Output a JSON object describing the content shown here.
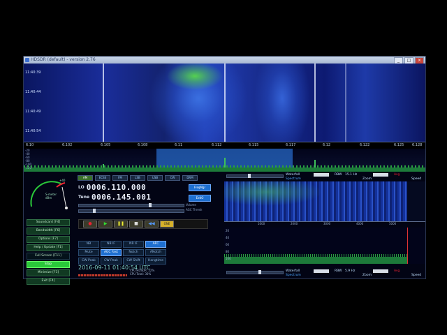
{
  "window": {
    "title": "HDSDR (default) - version 2.76",
    "buttons": [
      "_",
      "□",
      "×"
    ]
  },
  "waterfall": {
    "timestamps": [
      "11:40:39",
      "11:40:44",
      "11:40:49",
      "11:40:54"
    ]
  },
  "freq_ticks": [
    "6.10",
    "6.102",
    "6.105",
    "6.108",
    "6.11",
    "6.112",
    "6.115",
    "6.117",
    "6.12",
    "6.122",
    "6.125",
    "6.128"
  ],
  "spectrum": {
    "db_labels": [
      "-20",
      "-40",
      "-60",
      "-80",
      "-100",
      "-120"
    ]
  },
  "smeter": {
    "top_label": "+40",
    "label": "S-meter",
    "units": "dBm"
  },
  "tabs": [
    "AM",
    "ECSS",
    "FM",
    "LSB",
    "USB",
    "CW",
    "DRM"
  ],
  "lo": {
    "label": "LO",
    "value": "0006.110.000"
  },
  "tune": {
    "label": "Tune",
    "value": "0006.145.001"
  },
  "side_buttons": {
    "freq_mgr": "FreqMgr",
    "extio": "ExtIO"
  },
  "volume_label": "Volume",
  "agc_thresh_label": "AGC Thresh",
  "left_buttons": [
    {
      "label": "Soundcard [F4]",
      "style": "normal"
    },
    {
      "label": "Bandwidth [F6]",
      "style": "normal"
    },
    {
      "label": "Options [F7]",
      "style": "normal"
    },
    {
      "label": "Help / Update [F1]",
      "style": "normal"
    },
    {
      "label": "Full Screen [F11]",
      "style": "plain"
    },
    {
      "label": "Stop",
      "style": "on"
    },
    {
      "label": "Minimize [F3]",
      "style": "normal"
    },
    {
      "label": "Exit [F4]",
      "style": "normal"
    }
  ],
  "transport": {
    "record": "●",
    "play": "▶",
    "pause": "❚❚",
    "stop": "■",
    "rewind": "◀◀",
    "flag": "ONE"
  },
  "mode_buttons": [
    {
      "label": "NB",
      "selected": false
    },
    {
      "label": "NB IF",
      "selected": false
    },
    {
      "label": "NR IF",
      "selected": false
    },
    {
      "label": "AFC",
      "selected": true
    },
    {
      "label": "Mute",
      "selected": false
    },
    {
      "label": "AGC Fast",
      "selected": true
    },
    {
      "label": "Notch",
      "selected": false
    },
    {
      "label": "ANotch",
      "selected": false
    },
    {
      "label": "CW Peak",
      "selected": false
    },
    {
      "label": "CW Peak",
      "selected": false
    },
    {
      "label": "CW Shift",
      "selected": false
    },
    {
      "label": "Hangtime",
      "selected": false
    }
  ],
  "clock": "2016-09-11  01:40:54 UTC",
  "cpu": {
    "line1": "CPU HDSDR: 22%",
    "line2": "CPU Total: 36%"
  },
  "rcontrols_top": {
    "waterfall_label": "Waterfall",
    "rbw_label": "RBW",
    "rbw_value": "15.1 Hz",
    "avg_label": "Avg",
    "spectrum": "Spectrum",
    "zoom": "Zoom",
    "speed": "Speed"
  },
  "rcontrols_bottom": {
    "waterfall_label": "Waterfall",
    "rbw_label": "RBW",
    "rbw_value": "5.9 Hz",
    "avg_label": "Avg",
    "spectrum": "Spectrum",
    "zoom": "Zoom",
    "speed": "Speed"
  },
  "mini_ticks": [
    "1000",
    "2000",
    "3000",
    "4000",
    "5000"
  ],
  "mini_db": [
    "20",
    "40",
    "60",
    "80",
    "100"
  ]
}
